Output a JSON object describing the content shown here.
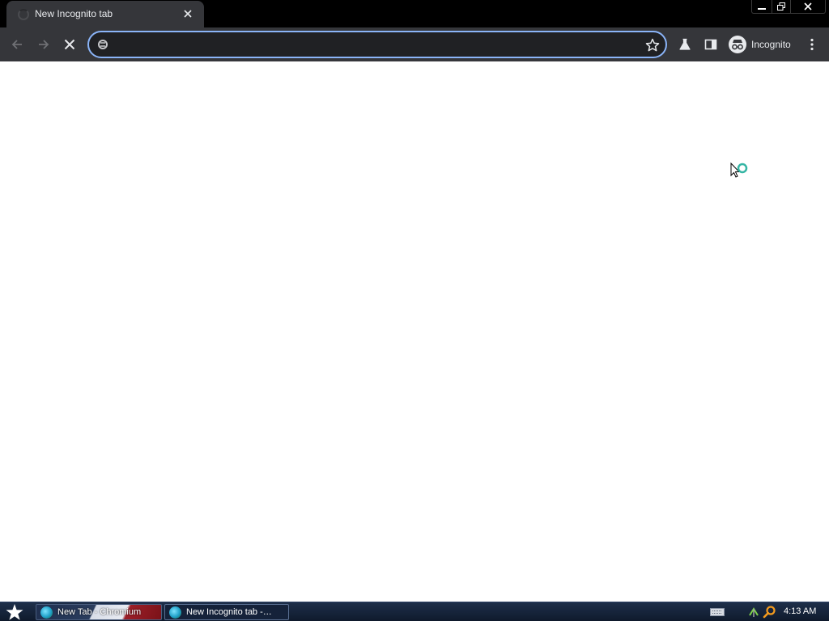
{
  "browser": {
    "tab": {
      "title": "New Incognito tab",
      "close_icon": "close-icon",
      "loading_icon": "spinner-icon"
    },
    "window_controls": {
      "minimize_icon": "minimize-icon",
      "restore_icon": "restore-icon",
      "close_icon": "close-icon"
    },
    "toolbar": {
      "back_icon": "arrow-left-icon",
      "forward_icon": "arrow-right-icon",
      "stop_icon": "stop-icon",
      "omnibox": {
        "value": "",
        "placeholder": "",
        "site_icon": "search-chip-icon",
        "bookmark_icon": "star-icon"
      },
      "labs_icon": "flask-icon",
      "side_panel_icon": "side-panel-icon",
      "profile_label": "Incognito",
      "profile_icon": "incognito-icon",
      "menu_icon": "kebab-menu-icon"
    },
    "colors": {
      "frame": "#000000",
      "toolbar": "#35363a",
      "omnibox_bg": "#202124",
      "focus_ring": "#8ab4f8",
      "text": "#e8eaed",
      "page_bg": "#ffffff"
    }
  },
  "taskbar": {
    "start_icon": "star-start-icon",
    "items": [
      {
        "label": "New Tab - Chromium",
        "icon": "chromium-icon"
      },
      {
        "label": "New Incognito tab -…",
        "icon": "chromium-icon"
      }
    ],
    "tray": {
      "keyboard_icon": "keyboard-icon",
      "network_icon": "network-icon",
      "search_icon": "search-icon"
    },
    "clock": "4:13 AM"
  }
}
